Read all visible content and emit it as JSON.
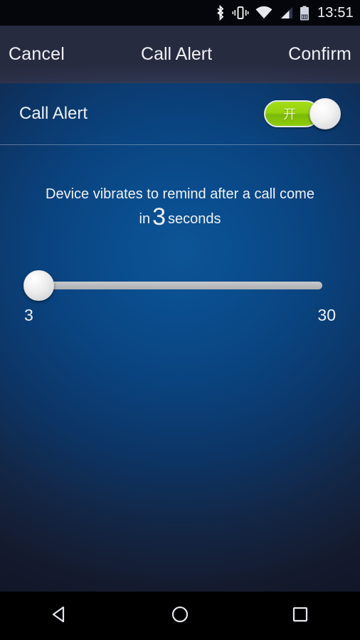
{
  "statusbar": {
    "icons": [
      "bluetooth-icon",
      "vibrate-icon",
      "wifi-icon",
      "signal-icon",
      "battery-icon"
    ],
    "time": "13:51"
  },
  "header": {
    "cancel_label": "Cancel",
    "title": "Call Alert",
    "confirm_label": "Confirm"
  },
  "settings_row": {
    "label": "Call Alert",
    "toggle": {
      "state_label": "开",
      "checked": "true",
      "on_color": "#95d20d"
    }
  },
  "description": {
    "prefix": "Device vibrates to remind after a call come in",
    "value": "3",
    "suffix": "seconds"
  },
  "slider": {
    "min_label": "3",
    "max_label": "30",
    "value": "3",
    "min": 3,
    "max": 30,
    "track_color": "#bbbdc0"
  },
  "navbar": {
    "back_label": "back-button",
    "home_label": "home-button",
    "recents_label": "recents-button"
  }
}
